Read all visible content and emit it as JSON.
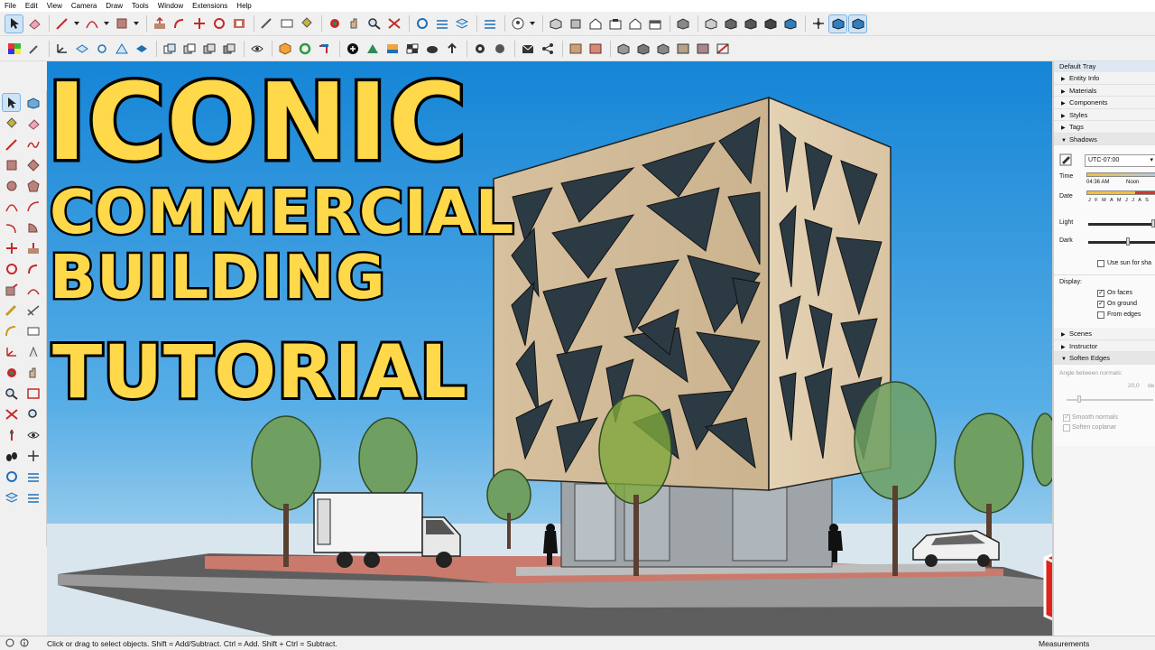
{
  "menu": [
    "File",
    "Edit",
    "View",
    "Camera",
    "Draw",
    "Tools",
    "Window",
    "Extensions",
    "Help"
  ],
  "overlay_title": {
    "line1": "ICONIC",
    "line2": "COMMERCIAL",
    "line3": "BUILDING",
    "line4": "TUTORIAL"
  },
  "tray": {
    "title": "Default Tray",
    "sections_top": [
      "Entity Info",
      "Materials",
      "Components",
      "Styles",
      "Tags",
      "Shadows"
    ],
    "shadows": {
      "timezone": "UTC-07:00",
      "time_label": "Time",
      "time_value": "04:36 AM",
      "noon_label": "Noon",
      "date_label": "Date",
      "months": "J F M A M J J A S",
      "light_label": "Light",
      "dark_label": "Dark",
      "use_sun_label": "Use sun for sha",
      "display_label": "Display:",
      "on_faces": "On faces",
      "on_ground": "On ground",
      "from_edges": "From edges"
    },
    "sections_bottom": [
      "Scenes",
      "Instructor",
      "Soften Edges"
    ],
    "soften": {
      "angle_label": "Angle between normals:",
      "angle_value": "20,0",
      "angle_unit": "de",
      "smooth_normals": "Smooth normals",
      "soften_coplanar": "Soften coplanar"
    }
  },
  "status": {
    "hint": "Click or drag to select objects. Shift = Add/Subtract. Ctrl = Add. Shift + Ctrl = Subtract.",
    "measurements_label": "Measurements"
  },
  "icons": {
    "toolbar1": [
      "select-icon",
      "eraser-icon",
      "pencil-line-icon",
      "arc-icon",
      "rectangle-icon",
      "push-pull-icon",
      "follow-me-icon",
      "move-icon",
      "rotate-icon",
      "offset-icon",
      "tape-measure-icon",
      "text-icon",
      "paint-bucket-icon",
      "orbit-icon",
      "pan-icon",
      "zoom-icon",
      "zoom-extents-icon",
      "warehouse-icon",
      "extension-warehouse-icon",
      "layout-icon",
      "components-icon",
      "user-icon",
      "iso-view-icon",
      "top-view-icon",
      "front-view-icon",
      "right-view-icon",
      "back-view-icon",
      "left-view-icon",
      "xray-icon",
      "back-edges-icon",
      "wireframe-icon",
      "hidden-line-icon",
      "shaded-icon",
      "textured-icon",
      "monochrome-icon",
      "position-camera-icon",
      "walk-icon",
      "look-around-icon"
    ],
    "colors": {
      "sky_top": "#1a8ad8",
      "sky_bottom": "#b9dbef",
      "title_fill": "#ffd94a",
      "facade": "#d8c3a3",
      "tree": "#6fa061",
      "logo_red": "#e0241b"
    }
  }
}
